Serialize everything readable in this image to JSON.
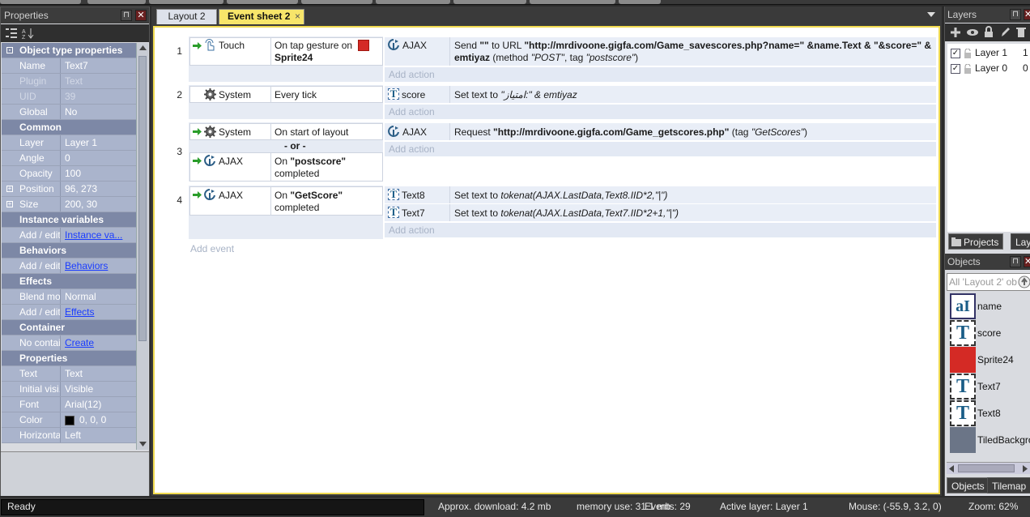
{
  "properties_panel": {
    "title": "Properties",
    "pin_icon": "pin-icon",
    "close_icon": "close-icon",
    "rows": [
      {
        "type": "category",
        "label": "Object type properties",
        "expander": "-"
      },
      {
        "type": "row",
        "key": "Name",
        "value": "Text7"
      },
      {
        "type": "row",
        "key": "Plugin",
        "value": "Text",
        "dim": true
      },
      {
        "type": "row",
        "key": "UID",
        "value": "39",
        "dim": true
      },
      {
        "type": "row",
        "key": "Global",
        "value": "No"
      },
      {
        "type": "category",
        "label": "Common",
        "expander": "-"
      },
      {
        "type": "row",
        "key": "Layer",
        "value": "Layer 1"
      },
      {
        "type": "row",
        "key": "Angle",
        "value": "0"
      },
      {
        "type": "row",
        "key": "Opacity",
        "value": "100"
      },
      {
        "type": "row",
        "key": "Position",
        "value": "96, 273",
        "expander": "+"
      },
      {
        "type": "row",
        "key": "Size",
        "value": "200, 30",
        "expander": "+"
      },
      {
        "type": "category",
        "label": "Instance variables",
        "expander": "-"
      },
      {
        "type": "row",
        "key": "Add / edit",
        "value": "Instance va...",
        "link": true
      },
      {
        "type": "category",
        "label": "Behaviors",
        "expander": "-"
      },
      {
        "type": "row",
        "key": "Add / edit",
        "value": "Behaviors",
        "link": true
      },
      {
        "type": "category",
        "label": "Effects",
        "expander": "-"
      },
      {
        "type": "row",
        "key": "Blend mode",
        "value": "Normal"
      },
      {
        "type": "row",
        "key": "Add / edit",
        "value": "Effects",
        "link": true
      },
      {
        "type": "category",
        "label": "Container",
        "expander": "-"
      },
      {
        "type": "row",
        "key": "No contai...",
        "value": "Create",
        "link": true
      },
      {
        "type": "category",
        "label": "Properties",
        "expander": "-"
      },
      {
        "type": "row",
        "key": "Text",
        "value": "Text"
      },
      {
        "type": "row",
        "key": "Initial visi...",
        "value": "Visible"
      },
      {
        "type": "row",
        "key": "Font",
        "value": "Arial(12)"
      },
      {
        "type": "row",
        "key": "Color",
        "value": "0, 0, 0",
        "swatch": "#000000"
      },
      {
        "type": "row",
        "key": "Horizontal...",
        "value": "Left"
      }
    ]
  },
  "tabs": [
    {
      "label": "Layout 2",
      "active": false
    },
    {
      "label": "Event sheet 2",
      "active": true,
      "close": "×"
    }
  ],
  "events": {
    "e1": {
      "num": "1",
      "cond_obj": "Touch",
      "cond_text1": "On tap gesture on",
      "cond_text2": "Sprite24",
      "act_obj": "AJAX",
      "act_p1": "Send ",
      "act_p2": "\"\"",
      "act_p3": " to URL ",
      "act_p4": "\"http://mrdivoone.gigfa.com/Game_savescores.php?name=\"",
      "act_p5": " &name.Text & ",
      "act_p6": "\"&score=\"",
      "act_p7": " &",
      "act_p8": "emtiyaz",
      "act_p9": " (method ",
      "act_p10": "\"POST\"",
      "act_p11": ", tag ",
      "act_p12": "\"postscore\"",
      "act_p13": ")",
      "add_action": "Add action"
    },
    "e2": {
      "num": "2",
      "cond_obj": "System",
      "cond_text": "Every tick",
      "act_obj": "score",
      "act_p1": "Set text to ",
      "act_p2": "\"امتیاز:\" & emtiyaz",
      "add_action": "Add action"
    },
    "e3": {
      "num": "3",
      "cond1_obj": "System",
      "cond1_text": "On start of layout",
      "or_label": "- or -",
      "cond2_obj": "AJAX",
      "cond2_text1": "On ",
      "cond2_text2": "\"postscore\"",
      "cond2_text3": "completed",
      "act_obj": "AJAX",
      "act_p1": "Request ",
      "act_p2": "\"http://mrdivoone.gigfa.com/Game_getscores.php\"",
      "act_p3": " (tag ",
      "act_p4": "\"GetScores\"",
      "act_p5": ")",
      "add_action": "Add action"
    },
    "e4": {
      "num": "4",
      "cond_obj": "AJAX",
      "cond_text1": "On ",
      "cond_text2": "\"GetScore\"",
      "cond_text3": "completed",
      "act1_obj": "Text8",
      "act1_p1": "Set text to ",
      "act1_p2": "tokenat(AJAX.LastData,Text8.IID*2,\"|\")",
      "act2_obj": "Text7",
      "act2_p1": "Set text to ",
      "act2_p2": "tokenat(AJAX.LastData,Text7.IID*2+1,\"|\")",
      "add_action": "Add action"
    },
    "add_event": "Add event"
  },
  "layers_panel": {
    "title": "Layers",
    "layers": [
      {
        "name": "Layer 1",
        "index": "1",
        "checked": true
      },
      {
        "name": "Layer 0",
        "index": "0",
        "checked": true
      }
    ],
    "bottom_tabs": [
      "Projects",
      "Layers"
    ]
  },
  "objects_panel": {
    "title": "Objects",
    "filter_placeholder": "All 'Layout 2' ob",
    "items": [
      {
        "name": "name",
        "icon": "text-input-icon"
      },
      {
        "name": "score",
        "icon": "text-icon"
      },
      {
        "name": "Sprite24",
        "icon": "sprite-icon",
        "color": "#d42a25"
      },
      {
        "name": "Text7",
        "icon": "text-icon"
      },
      {
        "name": "Text8",
        "icon": "text-icon"
      },
      {
        "name": "TiledBackgro",
        "icon": "tiled-background-icon",
        "color": "#6b7587"
      }
    ],
    "bottom_tabs": [
      "Objects",
      "Tilemap"
    ]
  },
  "status_bar": {
    "ready": "Ready",
    "download": "Approx. download: 4.2 mb",
    "memory": "memory use: 31.1 mb",
    "events": "Events: 29",
    "active_layer": "Active layer: Layer 1",
    "mouse": "Mouse: (-55.9, 3.2, 0)",
    "zoom": "Zoom: 62%"
  },
  "colors": {
    "accent_tab": "#f7e56a",
    "sprite_red": "#d42a25",
    "link_blue": "#1a3cff"
  }
}
